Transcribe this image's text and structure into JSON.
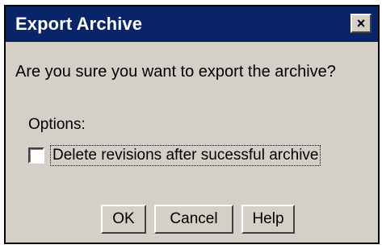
{
  "dialog": {
    "title": "Export Archive",
    "close_glyph": "×",
    "message": "Are you sure you want to export the archive?",
    "options_label": "Options:",
    "checkbox": {
      "label": "Delete revisions after sucessful archive",
      "checked": false
    },
    "buttons": {
      "ok": "OK",
      "cancel": "Cancel",
      "help": "Help"
    }
  },
  "colors": {
    "titlebar": "#0a246a",
    "dialog_face": "#d4d0c8"
  },
  "icons": {
    "close": "close-icon"
  }
}
